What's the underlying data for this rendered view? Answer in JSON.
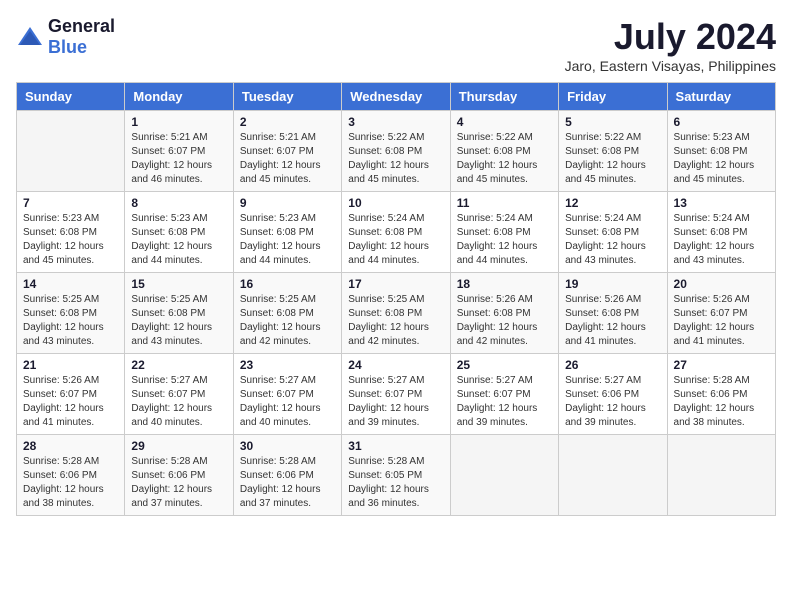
{
  "logo": {
    "text_general": "General",
    "text_blue": "Blue"
  },
  "title": "July 2024",
  "subtitle": "Jaro, Eastern Visayas, Philippines",
  "days_of_week": [
    "Sunday",
    "Monday",
    "Tuesday",
    "Wednesday",
    "Thursday",
    "Friday",
    "Saturday"
  ],
  "weeks": [
    [
      {
        "day": "",
        "info": ""
      },
      {
        "day": "1",
        "info": "Sunrise: 5:21 AM\nSunset: 6:07 PM\nDaylight: 12 hours\nand 46 minutes."
      },
      {
        "day": "2",
        "info": "Sunrise: 5:21 AM\nSunset: 6:07 PM\nDaylight: 12 hours\nand 45 minutes."
      },
      {
        "day": "3",
        "info": "Sunrise: 5:22 AM\nSunset: 6:08 PM\nDaylight: 12 hours\nand 45 minutes."
      },
      {
        "day": "4",
        "info": "Sunrise: 5:22 AM\nSunset: 6:08 PM\nDaylight: 12 hours\nand 45 minutes."
      },
      {
        "day": "5",
        "info": "Sunrise: 5:22 AM\nSunset: 6:08 PM\nDaylight: 12 hours\nand 45 minutes."
      },
      {
        "day": "6",
        "info": "Sunrise: 5:23 AM\nSunset: 6:08 PM\nDaylight: 12 hours\nand 45 minutes."
      }
    ],
    [
      {
        "day": "7",
        "info": "Sunrise: 5:23 AM\nSunset: 6:08 PM\nDaylight: 12 hours\nand 45 minutes."
      },
      {
        "day": "8",
        "info": "Sunrise: 5:23 AM\nSunset: 6:08 PM\nDaylight: 12 hours\nand 44 minutes."
      },
      {
        "day": "9",
        "info": "Sunrise: 5:23 AM\nSunset: 6:08 PM\nDaylight: 12 hours\nand 44 minutes."
      },
      {
        "day": "10",
        "info": "Sunrise: 5:24 AM\nSunset: 6:08 PM\nDaylight: 12 hours\nand 44 minutes."
      },
      {
        "day": "11",
        "info": "Sunrise: 5:24 AM\nSunset: 6:08 PM\nDaylight: 12 hours\nand 44 minutes."
      },
      {
        "day": "12",
        "info": "Sunrise: 5:24 AM\nSunset: 6:08 PM\nDaylight: 12 hours\nand 43 minutes."
      },
      {
        "day": "13",
        "info": "Sunrise: 5:24 AM\nSunset: 6:08 PM\nDaylight: 12 hours\nand 43 minutes."
      }
    ],
    [
      {
        "day": "14",
        "info": "Sunrise: 5:25 AM\nSunset: 6:08 PM\nDaylight: 12 hours\nand 43 minutes."
      },
      {
        "day": "15",
        "info": "Sunrise: 5:25 AM\nSunset: 6:08 PM\nDaylight: 12 hours\nand 43 minutes."
      },
      {
        "day": "16",
        "info": "Sunrise: 5:25 AM\nSunset: 6:08 PM\nDaylight: 12 hours\nand 42 minutes."
      },
      {
        "day": "17",
        "info": "Sunrise: 5:25 AM\nSunset: 6:08 PM\nDaylight: 12 hours\nand 42 minutes."
      },
      {
        "day": "18",
        "info": "Sunrise: 5:26 AM\nSunset: 6:08 PM\nDaylight: 12 hours\nand 42 minutes."
      },
      {
        "day": "19",
        "info": "Sunrise: 5:26 AM\nSunset: 6:08 PM\nDaylight: 12 hours\nand 41 minutes."
      },
      {
        "day": "20",
        "info": "Sunrise: 5:26 AM\nSunset: 6:07 PM\nDaylight: 12 hours\nand 41 minutes."
      }
    ],
    [
      {
        "day": "21",
        "info": "Sunrise: 5:26 AM\nSunset: 6:07 PM\nDaylight: 12 hours\nand 41 minutes."
      },
      {
        "day": "22",
        "info": "Sunrise: 5:27 AM\nSunset: 6:07 PM\nDaylight: 12 hours\nand 40 minutes."
      },
      {
        "day": "23",
        "info": "Sunrise: 5:27 AM\nSunset: 6:07 PM\nDaylight: 12 hours\nand 40 minutes."
      },
      {
        "day": "24",
        "info": "Sunrise: 5:27 AM\nSunset: 6:07 PM\nDaylight: 12 hours\nand 39 minutes."
      },
      {
        "day": "25",
        "info": "Sunrise: 5:27 AM\nSunset: 6:07 PM\nDaylight: 12 hours\nand 39 minutes."
      },
      {
        "day": "26",
        "info": "Sunrise: 5:27 AM\nSunset: 6:06 PM\nDaylight: 12 hours\nand 39 minutes."
      },
      {
        "day": "27",
        "info": "Sunrise: 5:28 AM\nSunset: 6:06 PM\nDaylight: 12 hours\nand 38 minutes."
      }
    ],
    [
      {
        "day": "28",
        "info": "Sunrise: 5:28 AM\nSunset: 6:06 PM\nDaylight: 12 hours\nand 38 minutes."
      },
      {
        "day": "29",
        "info": "Sunrise: 5:28 AM\nSunset: 6:06 PM\nDaylight: 12 hours\nand 37 minutes."
      },
      {
        "day": "30",
        "info": "Sunrise: 5:28 AM\nSunset: 6:06 PM\nDaylight: 12 hours\nand 37 minutes."
      },
      {
        "day": "31",
        "info": "Sunrise: 5:28 AM\nSunset: 6:05 PM\nDaylight: 12 hours\nand 36 minutes."
      },
      {
        "day": "",
        "info": ""
      },
      {
        "day": "",
        "info": ""
      },
      {
        "day": "",
        "info": ""
      }
    ]
  ]
}
